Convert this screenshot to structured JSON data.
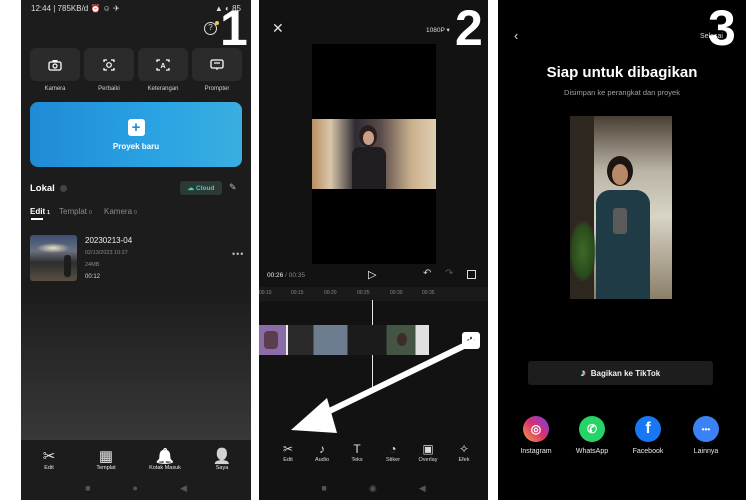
{
  "panel1": {
    "status_left": "12:44 | 785KB/d ⏰ ☺ ✈",
    "status_right": "▲ ◐ 85",
    "step_number": "1",
    "quick_actions": [
      {
        "label": "Kamera",
        "icon": "camera-icon"
      },
      {
        "label": "Perbaiki",
        "icon": "enhance-icon"
      },
      {
        "label": "Keterangan",
        "icon": "caption-icon"
      },
      {
        "label": "Prompter",
        "icon": "prompter-icon"
      }
    ],
    "new_project_label": "Proyek baru",
    "section_title": "Lokal",
    "cloud_label": "Cloud",
    "tabs": [
      {
        "label": "Edit",
        "count": "1"
      },
      {
        "label": "Templat",
        "count": "0"
      },
      {
        "label": "Kamera",
        "count": "0"
      }
    ],
    "project": {
      "name": "20230213-04",
      "date": "02/13/2023 10:27",
      "size": "24MB",
      "duration": "00:12"
    },
    "bottom_nav": [
      {
        "label": "Edit",
        "icon": "scissors-icon",
        "glyph": "✂"
      },
      {
        "label": "Templat",
        "icon": "template-icon",
        "glyph": "▦"
      },
      {
        "label": "Kotak Masuk",
        "icon": "bell-icon",
        "glyph": "🔔"
      },
      {
        "label": "Saya",
        "icon": "profile-icon",
        "glyph": "👤"
      }
    ]
  },
  "panel2": {
    "step_number": "2",
    "resolution": "1080P",
    "time_current": "00:26",
    "time_total": "00:35",
    "ruler": [
      "00:10",
      "00:15",
      "00:20",
      "00:25",
      "00:30",
      "00:35"
    ],
    "toolbar": [
      {
        "label": "Edit",
        "glyph": "✂",
        "icon": "scissors-icon"
      },
      {
        "label": "Audio",
        "glyph": "♪",
        "icon": "audio-icon"
      },
      {
        "label": "Teks",
        "glyph": "T",
        "icon": "text-icon"
      },
      {
        "label": "Stiker",
        "glyph": "◔",
        "icon": "sticker-icon"
      },
      {
        "label": "Overlay",
        "glyph": "▣",
        "icon": "overlay-icon"
      },
      {
        "label": "Efek",
        "glyph": "✧",
        "icon": "effect-icon"
      }
    ]
  },
  "panel3": {
    "step_number": "3",
    "done_label": "Selesai",
    "title": "Siap untuk dibagikan",
    "subtitle": "Disimpan ke perangkat dan proyek",
    "tiktok_button": "Bagikan ke TikTok",
    "share_targets": [
      {
        "label": "Instagram",
        "icon": "instagram-icon",
        "glyph": "◎",
        "color": "#d6336c"
      },
      {
        "label": "WhatsApp",
        "icon": "whatsapp-icon",
        "glyph": "✆",
        "color": "#25d366"
      },
      {
        "label": "Facebook",
        "icon": "facebook-icon",
        "glyph": "f",
        "color": "#1877f2"
      },
      {
        "label": "Lainnya",
        "icon": "more-icon",
        "glyph": "•••",
        "color": "#3b82f6"
      }
    ]
  }
}
